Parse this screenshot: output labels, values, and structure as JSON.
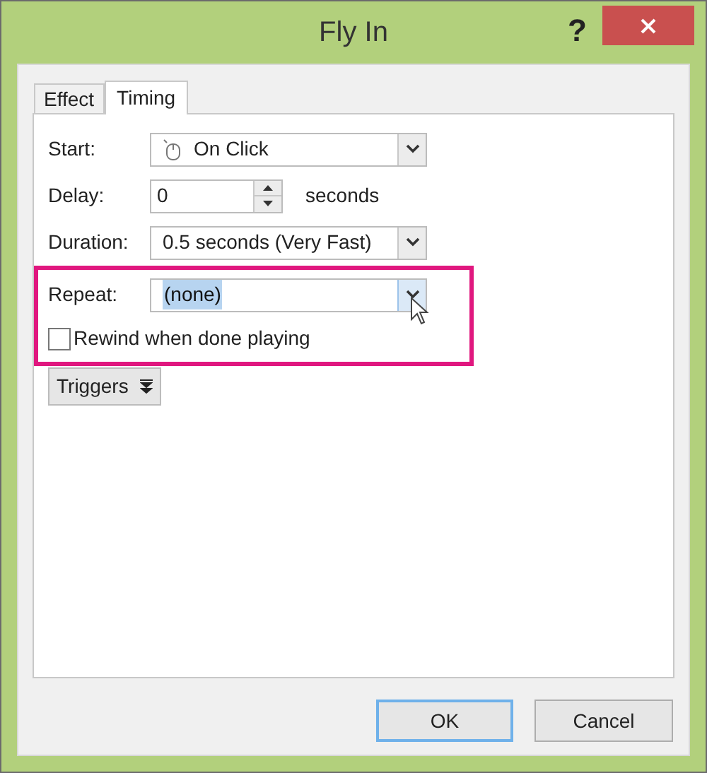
{
  "window": {
    "title": "Fly In",
    "help": "?"
  },
  "tabs": [
    {
      "label": "Effect",
      "selected": false
    },
    {
      "label": "Timing",
      "selected": true
    }
  ],
  "fields": [
    {
      "kind": "dropdown",
      "label": "Start:",
      "value": "On Click"
    },
    {
      "kind": "spinner",
      "label": "Delay:",
      "value": "0",
      "unit": "seconds"
    },
    {
      "kind": "dropdown",
      "label": "Duration:",
      "value": "0.5 seconds (Very Fast)"
    }
  ],
  "highlighted_box": {
    "repeat": {
      "kind": "dropdown",
      "label": "Repeat:",
      "value": "(none)",
      "focused": true
    },
    "rewind": {
      "label": "Rewind when done playing",
      "checked": false
    }
  },
  "triggers_button": {
    "label": "Triggers"
  },
  "buttons": [
    {
      "label": "OK",
      "default": true
    },
    {
      "label": "Cancel",
      "default": false
    }
  ]
}
